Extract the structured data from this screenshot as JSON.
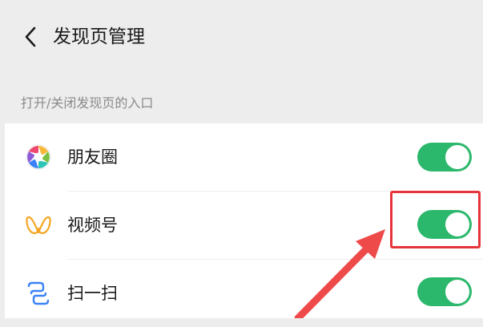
{
  "header": {
    "back_icon": "chevron-left-icon",
    "title": "发现页管理"
  },
  "section": {
    "label": "打开/关闭发现页的入口"
  },
  "items": [
    {
      "label": "朋友圈",
      "icon": "moments-aperture-icon",
      "enabled": true
    },
    {
      "label": "视频号",
      "icon": "channels-butterfly-icon",
      "enabled": true
    },
    {
      "label": "扫一扫",
      "icon": "scan-icon",
      "enabled": true
    }
  ],
  "annotation": {
    "highlight_color": "#e5353a",
    "arrow_color": "#ef4a4a"
  },
  "colors": {
    "toggle_on": "#2cb86c",
    "background": "#ededed"
  }
}
